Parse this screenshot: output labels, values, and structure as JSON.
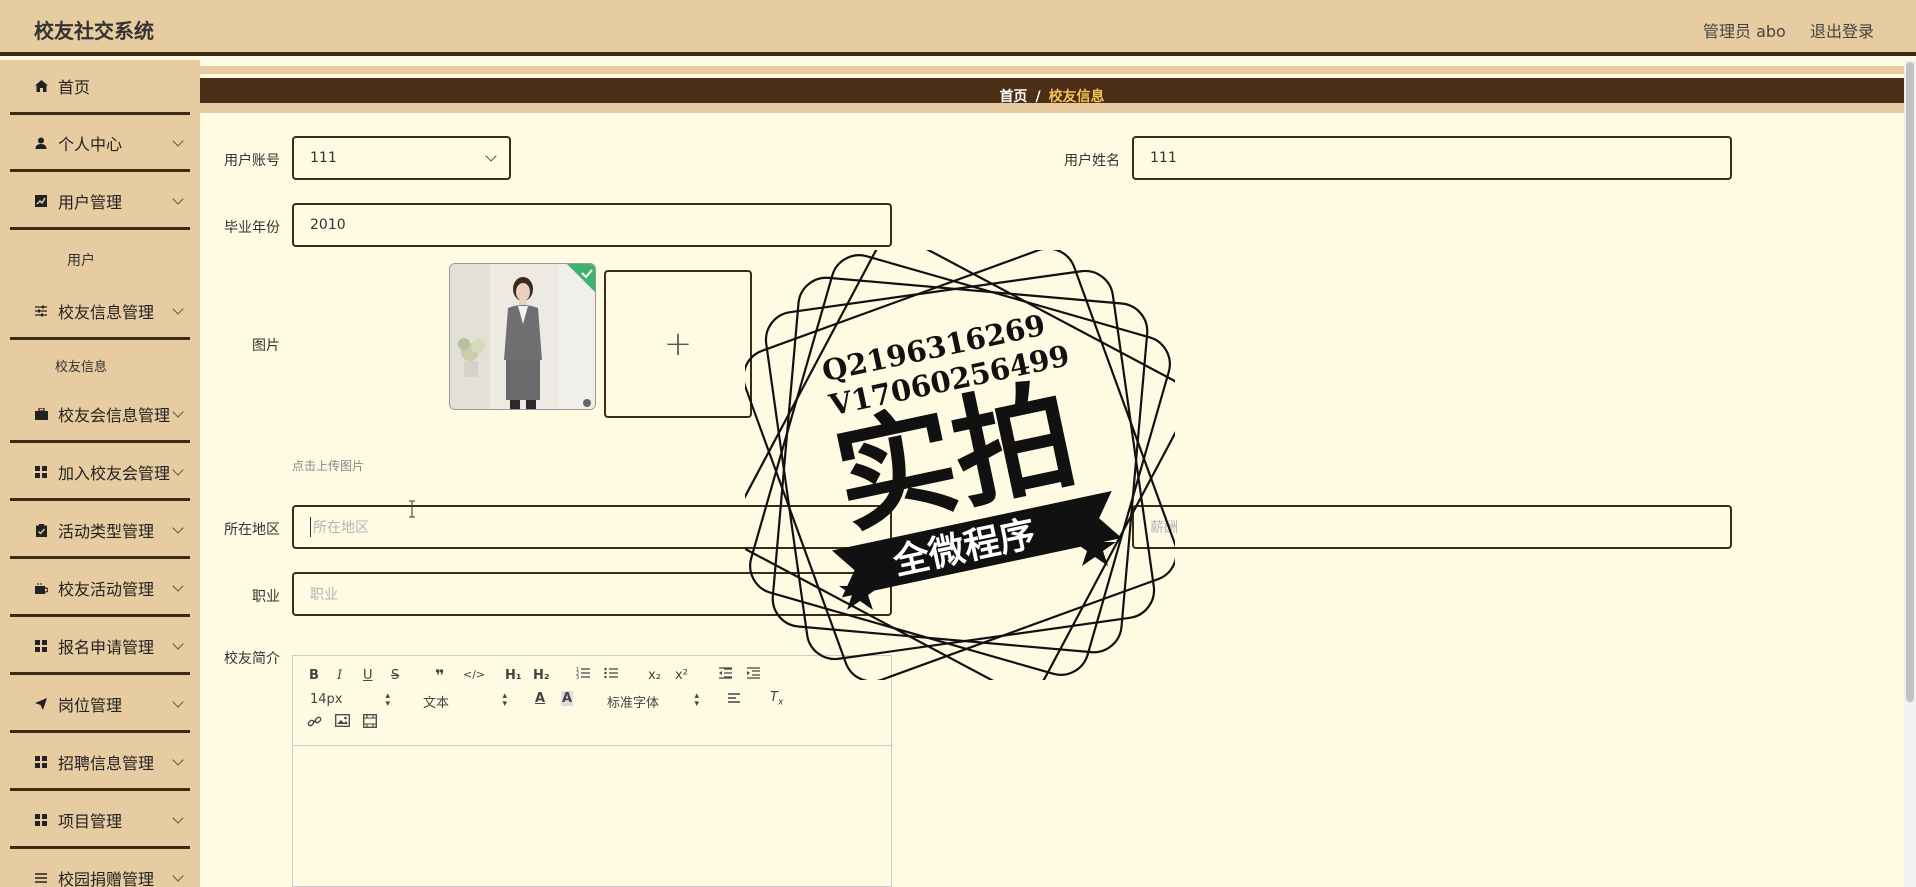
{
  "header": {
    "title": "校友社交系统",
    "admin_label": "管理员 abo",
    "logout_label": "退出登录"
  },
  "sidebar": {
    "items": [
      {
        "label": "首页",
        "icon": "home-icon"
      },
      {
        "label": "个人中心",
        "icon": "user-icon"
      },
      {
        "label": "用户管理",
        "icon": "chart-icon"
      },
      {
        "label": "校友信息管理",
        "icon": "sliders-icon"
      },
      {
        "label": "校友会信息管理",
        "icon": "briefcase-icon"
      },
      {
        "label": "加入校友会管理",
        "icon": "grid-icon"
      },
      {
        "label": "活动类型管理",
        "icon": "clipboard-icon"
      },
      {
        "label": "校友活动管理",
        "icon": "coffee-icon"
      },
      {
        "label": "报名申请管理",
        "icon": "grid-icon"
      },
      {
        "label": "岗位管理",
        "icon": "send-icon"
      },
      {
        "label": "招聘信息管理",
        "icon": "grid-icon"
      },
      {
        "label": "项目管理",
        "icon": "grid-icon"
      },
      {
        "label": "校园捐赠管理",
        "icon": "list-icon"
      }
    ],
    "sub_user": "用户",
    "sub_alumni": "校友信息"
  },
  "breadcrumb": {
    "home": "首页",
    "separator": "/",
    "current": "校友信息"
  },
  "form": {
    "account_label": "用户账号",
    "account_value": "111",
    "name_label": "用户姓名",
    "name_value": "111",
    "grad_year_label": "毕业年份",
    "grad_year_value": "2010",
    "image_label": "图片",
    "upload_tip": "点击上传图片",
    "region_label": "所在地区",
    "region_placeholder": "所在地区",
    "salary_placeholder": "薪酬",
    "job_label": "职业",
    "job_placeholder": "职业",
    "intro_label": "校友简介"
  },
  "editor": {
    "font_size": "14px",
    "header_select": "文本",
    "font_family": "标准字体"
  },
  "watermark": {
    "line1": "Q2196316269",
    "line2": "V17060256499",
    "big_text": "实拍",
    "banner_text": "全微程序"
  },
  "colors": {
    "header_bg": "#e8cca1",
    "dark_brown": "#4a2e16",
    "accent_gold": "#f4c256",
    "page_bg": "#fefbe2"
  }
}
